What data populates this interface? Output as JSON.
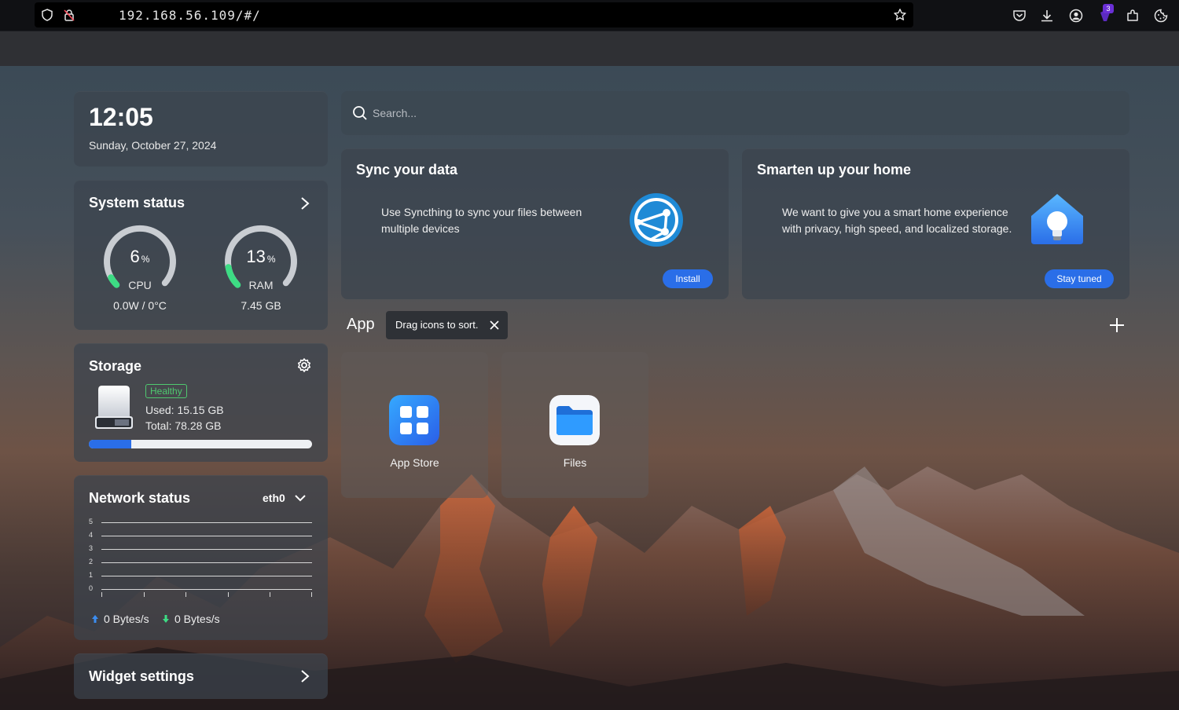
{
  "browser": {
    "url": "192.168.56.109/#/",
    "extension_badge": "3"
  },
  "clock": {
    "time": "12:05",
    "date": "Sunday, October 27, 2024"
  },
  "system_status": {
    "title": "System status",
    "cpu": {
      "value": "6",
      "unit": "%",
      "label": "CPU",
      "sub": "0.0W / 0°C",
      "percent": 6
    },
    "ram": {
      "value": "13",
      "unit": "%",
      "label": "RAM",
      "sub": "7.45 GB",
      "percent": 13
    }
  },
  "storage": {
    "title": "Storage",
    "health": "Healthy",
    "used": "Used: 15.15 GB",
    "total": "Total: 78.28 GB",
    "used_fraction": 0.19
  },
  "network": {
    "title": "Network status",
    "interface": "eth0",
    "y_ticks": [
      "5",
      "4",
      "3",
      "2",
      "1",
      "0"
    ],
    "upload": "0 Bytes/s",
    "download": "0 Bytes/s"
  },
  "widget_settings": {
    "title": "Widget settings"
  },
  "search": {
    "placeholder": "Search..."
  },
  "promos": [
    {
      "title": "Sync your data",
      "description": "Use Syncthing to sync your files between multiple devices",
      "button": "Install"
    },
    {
      "title": "Smarten up your home",
      "description": "We want to give you a smart home experience with privacy, high speed, and localized storage.",
      "button": "Stay tuned"
    }
  ],
  "apps_section": {
    "heading": "App",
    "tooltip": "Drag icons to sort.",
    "apps": [
      {
        "name": "App Store",
        "icon": "app-store-icon"
      },
      {
        "name": "Files",
        "icon": "files-icon"
      }
    ]
  },
  "colors": {
    "accent": "#2a6ee8",
    "gauge_fill": "#3ddc84",
    "healthy": "#4fc86f"
  }
}
